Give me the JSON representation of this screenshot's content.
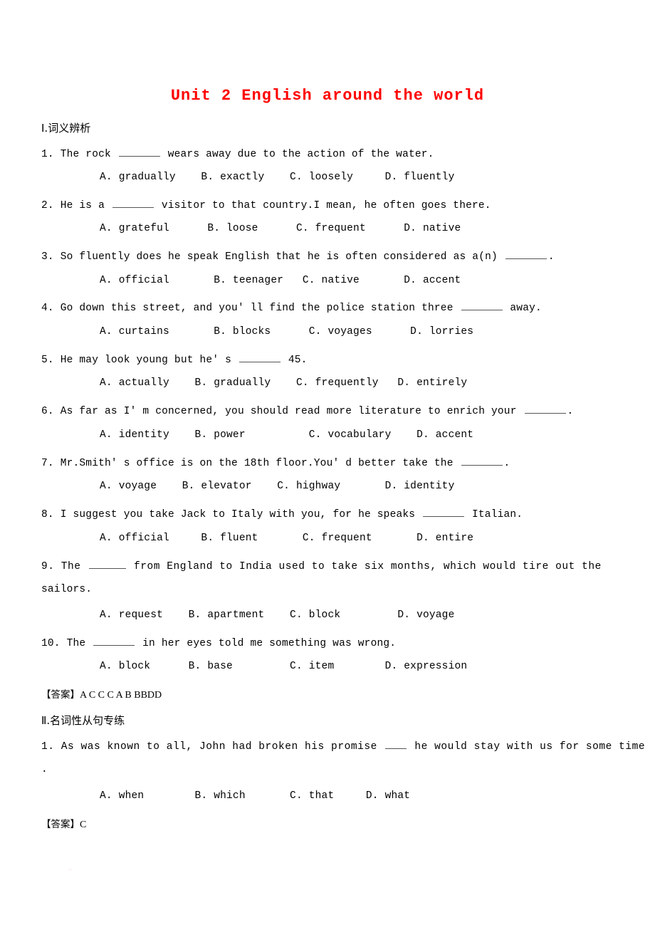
{
  "document": {
    "title": "Unit 2 English around the world",
    "title_color": "#ff0000"
  },
  "sections": [
    {
      "heading": "Ⅰ.词义辨析",
      "answer_label": "【答案】",
      "answer_value": "A C C C A B BBDD",
      "questions": [
        {
          "number": "1.",
          "stem_before": "1. The rock ",
          "stem_after": " wears away due to the action of the water.",
          "options": "A. gradually    B. exactly    C. loosely     D. fluently"
        },
        {
          "number": "2.",
          "stem_before": "2. He is a ",
          "stem_after": " visitor to that country.I mean, he often goes there.",
          "options": "A. grateful      B. loose      C. frequent      D. native"
        },
        {
          "number": "3.",
          "stem_before": "3. So fluently does he speak English that he is often considered as a(n) ",
          "stem_after": ".",
          "options": "A. official       B. teenager   C. native       D. accent"
        },
        {
          "number": "4.",
          "stem_before": "4. Go down this street, and you' ll find the police station three ",
          "stem_after": " away.",
          "options": "A. curtains       B. blocks      C. voyages      D. lorries"
        },
        {
          "number": "5.",
          "stem_before": "5. He may look young but he' s ",
          "stem_after": " 45.",
          "options": "A. actually    B. gradually    C. frequently   D. entirely"
        },
        {
          "number": "6.",
          "stem_before": "6. As far as I' m concerned, you should read more literature to enrich your ",
          "stem_after": ".",
          "options": "A. identity    B. power          C. vocabulary    D. accent"
        },
        {
          "number": "7.",
          "stem_before": "7. Mr.Smith' s office is on the 18th floor.You' d better take the ",
          "stem_after": ".",
          "options": "A. voyage    B. elevator    C. highway       D. identity"
        },
        {
          "number": "8.",
          "stem_before": "8. I suggest you take Jack to Italy with you, for he speaks ",
          "stem_after": " Italian.",
          "options": "A. official     B. fluent       C. frequent       D. entire"
        },
        {
          "number": "9.",
          "stem_before": "9. The ",
          "stem_after": " from England to India used to take six months, which would tire out the",
          "stem_line2": "sailors.",
          "options": "A. request    B. apartment    C. block         D. voyage"
        },
        {
          "number": "10.",
          "stem_before": "10. The ",
          "stem_after": " in her eyes told me something was wrong.",
          "options": "A. block      B. base         C. item        D. expression"
        }
      ]
    },
    {
      "heading": "Ⅱ.名词性从句专练",
      "answer_label": "【答案】",
      "answer_value": "C",
      "questions": [
        {
          "number": "1.",
          "stem_before": "1. As was known to all, John had broken his promise ",
          "stem_after": " he would stay with us for some time",
          "stem_line2": ".",
          "options": "A. when        B. which       C. that     D. what"
        }
      ]
    }
  ],
  "artifact": {
    "speck": "··"
  }
}
